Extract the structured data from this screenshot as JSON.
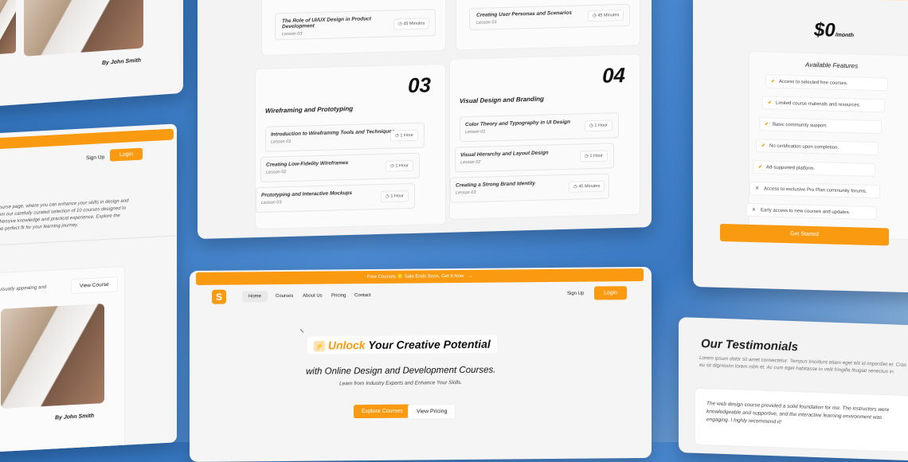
{
  "top_left_card": {
    "author": "By John Smith"
  },
  "left_card": {
    "signup": "Sign Up",
    "login": "Login",
    "intro": [
      "course page, where you can enhance your skills in design and",
      "rom our carefully curated selection of 10 courses designed to",
      "ehensive knowledge and practical experience. Explore the",
      "the perfect fit for your learning journey."
    ],
    "partial_text": "visually appealing and",
    "view_course": "View Course",
    "author": "By John Smith"
  },
  "curriculum": {
    "top_lessons": [
      {
        "title": "The Role of UI/UX Design in Product Development",
        "sub": "Lesson 03",
        "dur": "45 Minutes"
      },
      {
        "title": "Creating User Personas and Scenarios",
        "sub": "Lesson 03",
        "dur": "45 Minutes"
      }
    ],
    "modules": [
      {
        "num": "03",
        "title": "Wireframing and Prototyping",
        "lessons": [
          {
            "title": "Introduction to Wireframing Tools and Techniques",
            "sub": "Lesson 01",
            "dur": "1 Hour"
          },
          {
            "title": "Creating Low-Fidelity Wireframes",
            "sub": "Lesson 02",
            "dur": "1 Hour"
          },
          {
            "title": "Prototyping and Interactive Mockups",
            "sub": "Lesson 03",
            "dur": "1 Hour"
          }
        ]
      },
      {
        "num": "04",
        "title": "Visual Design and Branding",
        "lessons": [
          {
            "title": "Color Theory and Typography in UI Design",
            "sub": "Lesson 01",
            "dur": "1 Hour"
          },
          {
            "title": "Visual Hierarchy and Layout Design",
            "sub": "Lesson 02",
            "dur": "1 Hour"
          },
          {
            "title": "Creating a Strong Brand Identity",
            "sub": "Lesson 03",
            "dur": "45 Minutes"
          }
        ]
      }
    ]
  },
  "pricing": {
    "price": "$0",
    "period": "/month",
    "features_title": "Available Features",
    "features": [
      {
        "text": "Access to selected free courses.",
        "ok": true
      },
      {
        "text": "Limited course materials and resources.",
        "ok": true
      },
      {
        "text": "Basic community support.",
        "ok": true
      },
      {
        "text": "No certification upon completion.",
        "ok": true
      },
      {
        "text": "Ad-supported platform.",
        "ok": true
      },
      {
        "text": "Access to exclusive Pro Plan community forums.",
        "ok": false
      },
      {
        "text": "Early access to new courses and updates.",
        "ok": false
      }
    ],
    "cta": "Get Started"
  },
  "hero": {
    "banner": "Free Courses 🌟 Sale Ends Soon, Get It Now",
    "nav": [
      "Home",
      "Courses",
      "About Us",
      "Pricing",
      "Contact"
    ],
    "signup": "Sign Up",
    "login": "Login",
    "headline_accent": "Unlock",
    "headline_rest": "Your Creative Potential",
    "subheadline": "with Online Design and Development Courses.",
    "tagline": "Learn from Industry Experts and Enhance Your Skills.",
    "explore": "Explore Courses",
    "pricing": "View Pricing"
  },
  "testimonials": {
    "title": "Our Testimonials",
    "lede": "Lorem ipsum dolor sit amet consectetur. Tempus tincidunt etiam eget elit id imperdiet et. Cras eu sit dignissim lorem nibh et. Ac cum eget habitasse in velit fringilla feugiat senectus in.",
    "quote": "The web design course provided a solid foundation for me. The instructors were knowledgeable and supportive, and the interactive learning environment was engaging. I highly recommend it!"
  },
  "colors": {
    "accent": "#f99a10",
    "background": "#3a79c2"
  }
}
